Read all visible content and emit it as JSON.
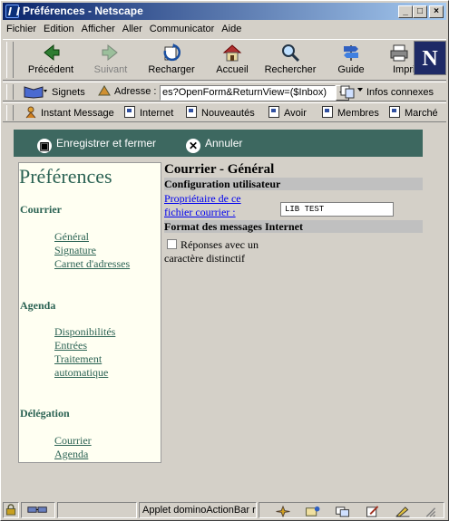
{
  "window": {
    "title": "Préférences - Netscape"
  },
  "menu": [
    "Fichier",
    "Edition",
    "Afficher",
    "Aller",
    "Communicator",
    "Aide"
  ],
  "nav": {
    "back": "Précédent",
    "forward": "Suivant",
    "reload": "Recharger",
    "home": "Accueil",
    "search": "Rechercher",
    "guide": "Guide",
    "print": "Impri"
  },
  "location": {
    "bookmarks": "Signets",
    "address_label": "Adresse :",
    "url": "es?OpenForm&ReturnView=($Inbox)",
    "related": "Infos connexes"
  },
  "personal_bar": [
    "Instant Message",
    "Internet",
    "Nouveautés",
    "Avoir",
    "Membres",
    "Marché"
  ],
  "actions": {
    "save_close": "Enregistrer et fermer",
    "cancel": "Annuler"
  },
  "sidebar": {
    "title": "Préférences",
    "sections": [
      {
        "heading": "Courrier",
        "links": [
          "Général",
          "Signature",
          "Carnet d'adresses"
        ]
      },
      {
        "heading": "Agenda",
        "links": [
          "Disponibilités",
          "Entrées",
          "Traitement automatique"
        ]
      },
      {
        "heading": "Délégation",
        "links": [
          "Courrier",
          "Agenda"
        ]
      }
    ]
  },
  "form": {
    "title": "Courrier - Général",
    "section1": "Configuration utilisateur",
    "owner_label": "Propriétaire de ce fichier courrier :",
    "owner_value": "LIB TEST",
    "section2": "Format des messages Internet",
    "checkbox_label": "Réponses avec un caractère distinctif",
    "checkbox_checked": false
  },
  "status": {
    "text": "Applet dominoActionBar ru"
  }
}
